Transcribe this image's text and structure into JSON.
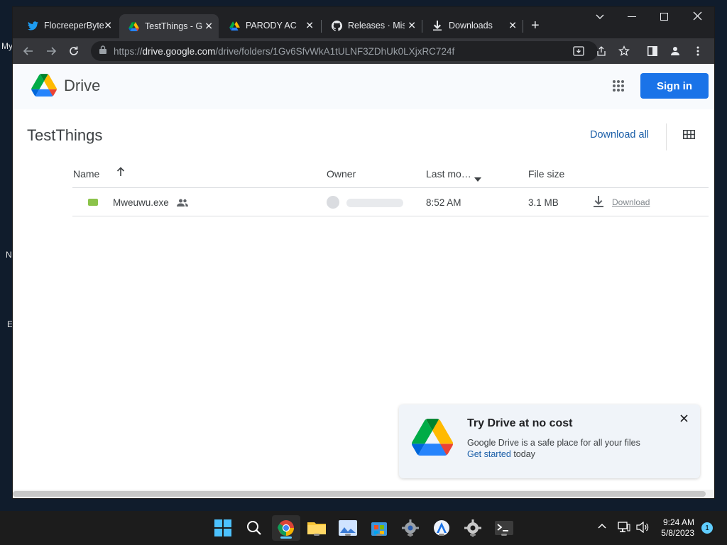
{
  "desktop": {
    "labels": [
      "My",
      "N",
      "E"
    ]
  },
  "browser": {
    "tabs": [
      {
        "title": "FlocreeperByte",
        "icon": "twitter-icon",
        "active": false
      },
      {
        "title": "TestThings - G",
        "icon": "google-drive-icon",
        "active": true
      },
      {
        "title": "PARODY ACC",
        "icon": "google-drive-icon",
        "active": false
      },
      {
        "title": "Releases · Mish",
        "icon": "github-icon",
        "active": false
      },
      {
        "title": "Downloads",
        "icon": "download-icon",
        "active": false
      }
    ],
    "url": {
      "scheme": "https://",
      "host": "drive.google.com",
      "path": "/drive/folders/1Gv6SfvWkA1tULNF3ZDhUk0LXjxRC724f"
    }
  },
  "drive": {
    "brand": "Drive",
    "sign_in_label": "Sign in",
    "folder_title": "TestThings",
    "download_all_label": "Download all",
    "columns": {
      "name": "Name",
      "owner": "Owner",
      "last_modified": "Last mo…",
      "file_size": "File size"
    },
    "files": [
      {
        "name": "Mweuwu.exe",
        "shared": true,
        "last_modified": "8:52 AM",
        "size": "3.1 MB",
        "download_label": "Download"
      }
    ]
  },
  "promo": {
    "title": "Try Drive at no cost",
    "description": "Google Drive is a safe place for all your files",
    "link": "Get started",
    "link_suffix": " today"
  },
  "taskbar": {
    "time": "9:24 AM",
    "date": "5/8/2023",
    "notifications": "1"
  },
  "colors": {
    "accent": "#1a73e8",
    "link": "#1a5ea8",
    "tabbar": "#202124",
    "toolbar": "#35363a"
  }
}
